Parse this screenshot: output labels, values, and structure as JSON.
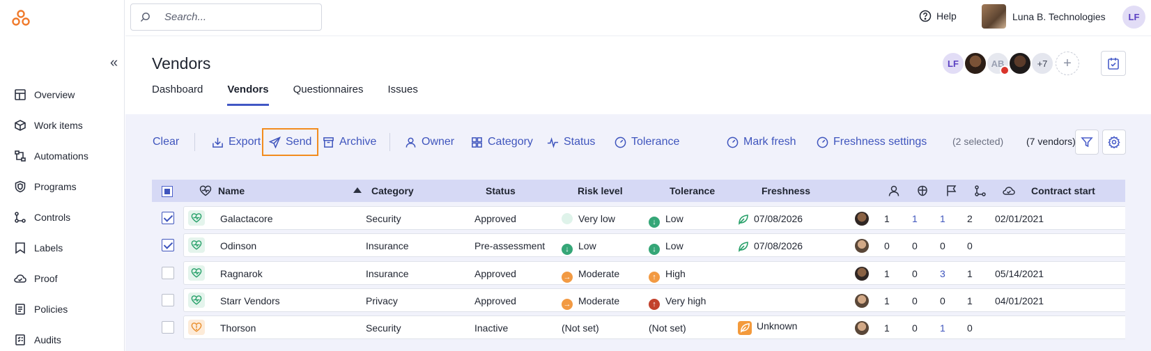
{
  "search": {
    "placeholder": "Search..."
  },
  "header": {
    "help": "Help",
    "org": "Luna B. Technologies",
    "user_initials": "LF"
  },
  "sidebar": {
    "collapse": "«",
    "items": [
      {
        "label": "Overview",
        "icon": "overview-icon"
      },
      {
        "label": "Work items",
        "icon": "work-items-icon"
      },
      {
        "label": "Automations",
        "icon": "automations-icon"
      },
      {
        "label": "Programs",
        "icon": "shield-icon"
      },
      {
        "label": "Controls",
        "icon": "controls-icon"
      },
      {
        "label": "Labels",
        "icon": "label-icon"
      },
      {
        "label": "Proof",
        "icon": "cloud-icon"
      },
      {
        "label": "Policies",
        "icon": "policies-icon"
      },
      {
        "label": "Audits",
        "icon": "audits-icon"
      }
    ]
  },
  "page": {
    "title": "Vendors",
    "avatars": {
      "lf": "LF",
      "ab": "AB",
      "more": "+7",
      "add": "+"
    },
    "tabs": [
      "Dashboard",
      "Vendors",
      "Questionnaires",
      "Issues"
    ],
    "active_tab": "Vendors"
  },
  "toolbar": {
    "clear": "Clear",
    "export": "Export",
    "send": "Send",
    "archive": "Archive",
    "owner": "Owner",
    "category": "Category",
    "status": "Status",
    "tolerance": "Tolerance",
    "mark_fresh": "Mark fresh",
    "freshness_settings": "Freshness settings",
    "selected": "(2 selected)",
    "count": "(7 vendors)"
  },
  "table": {
    "headers": {
      "name": "Name",
      "category": "Category",
      "status": "Status",
      "risk": "Risk level",
      "tolerance": "Tolerance",
      "freshness": "Freshness",
      "contract_start": "Contract start"
    },
    "rows": [
      {
        "checked": true,
        "name": "Galactacore",
        "category": "Security",
        "status": "Approved",
        "risk": "Very low",
        "tolerance": "Low",
        "freshness": "07/08/2026",
        "c1": "1",
        "c2": "1",
        "c3": "1",
        "c4": "2",
        "contract_start": "02/01/2021"
      },
      {
        "checked": true,
        "name": "Odinson",
        "category": "Insurance",
        "status": "Pre-assessment",
        "risk": "Low",
        "tolerance": "Low",
        "freshness": "07/08/2026",
        "c1": "0",
        "c2": "0",
        "c3": "0",
        "c4": "0",
        "contract_start": ""
      },
      {
        "checked": false,
        "name": "Ragnarok",
        "category": "Insurance",
        "status": "Approved",
        "risk": "Moderate",
        "tolerance": "High",
        "freshness": "",
        "c1": "1",
        "c2": "0",
        "c3": "3",
        "c4": "1",
        "contract_start": "05/14/2021"
      },
      {
        "checked": false,
        "name": "Starr Vendors",
        "category": "Privacy",
        "status": "Approved",
        "risk": "Moderate",
        "tolerance": "Very high",
        "freshness": "",
        "c1": "1",
        "c2": "0",
        "c3": "0",
        "c4": "1",
        "contract_start": "04/01/2021"
      },
      {
        "checked": false,
        "name": "Thorson",
        "category": "Security",
        "status": "Inactive",
        "risk": "(Not set)",
        "tolerance": "(Not set)",
        "freshness": "Unknown",
        "c1": "1",
        "c2": "0",
        "c3": "1",
        "c4": "0",
        "contract_start": ""
      }
    ]
  },
  "colors": {
    "accent": "#3f55bd",
    "highlight": "#f28c1e",
    "panel": "#f1f2fb",
    "header_row": "#d6d9f5"
  }
}
